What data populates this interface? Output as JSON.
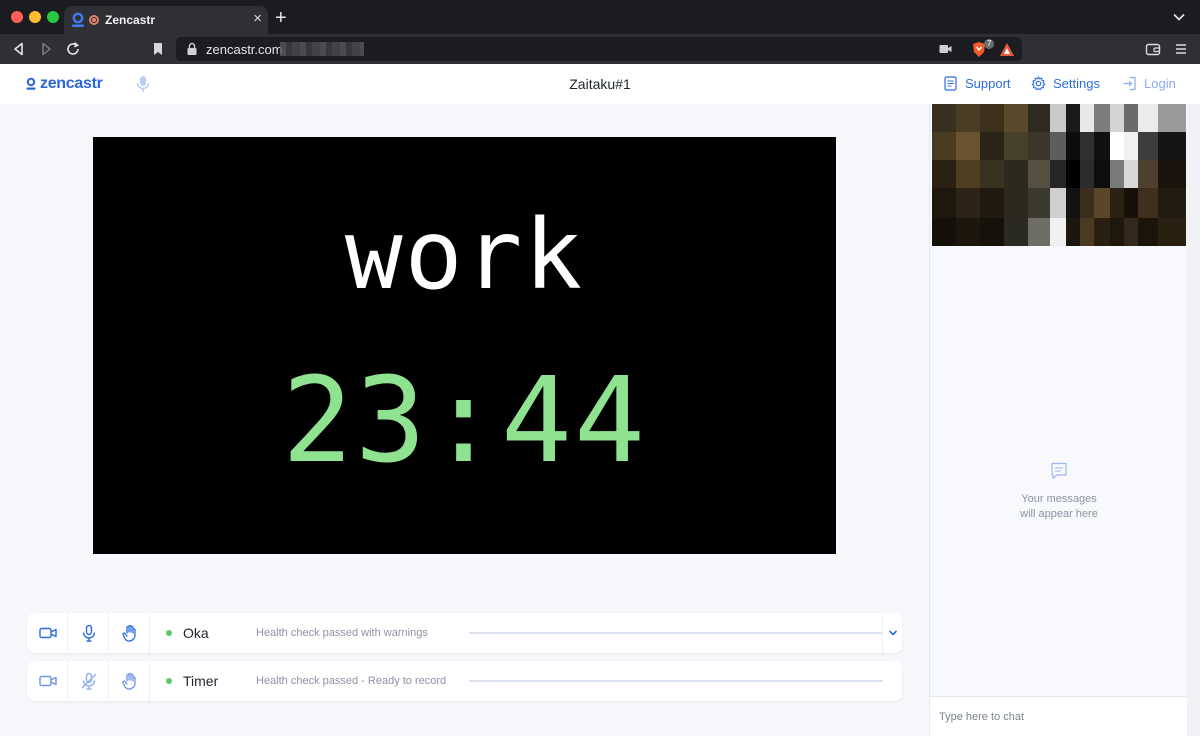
{
  "browser": {
    "tab_title": "Zencastr",
    "tab_close": "×",
    "new_tab": "+",
    "url": "zencastr.com",
    "brave_shield_count": "7"
  },
  "header": {
    "logo_text": "zencastr",
    "session_title": "Zaitaku#1",
    "support_label": "Support",
    "settings_label": "Settings",
    "login_label": "Login"
  },
  "video": {
    "word": "work",
    "time": "23:44"
  },
  "participants": [
    {
      "name": "Oka",
      "status": "Health check passed with warnings",
      "mic_muted": false
    },
    {
      "name": "Timer",
      "status": "Health check passed - Ready to record",
      "mic_muted": true
    }
  ],
  "chat": {
    "empty_line1": "Your messages",
    "empty_line2": "will appear here",
    "input_placeholder": "Type here to chat"
  },
  "colors": {
    "brand_blue": "#2c66dd",
    "timer_green": "#8fe28f",
    "status_green": "#5dc86a"
  }
}
